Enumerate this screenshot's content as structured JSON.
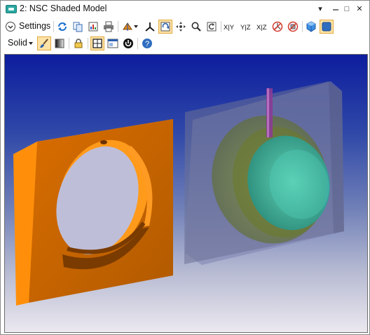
{
  "window": {
    "title": "2: NSC Shaded Model",
    "minimize": "▾",
    "restore": "□",
    "close": "✕"
  },
  "toolbar1": {
    "settings_label": "Settings",
    "axis_xy": "X|Y",
    "axis_yz": "Y|Z",
    "axis_xz": "X|Z"
  },
  "toolbar2": {
    "mode_label": "Solid"
  },
  "colors": {
    "accent": "#fde3a7",
    "viewport_top": "#0d1d9e",
    "viewport_bottom": "#ebe8ef",
    "orange_part": "#ff8c00"
  }
}
